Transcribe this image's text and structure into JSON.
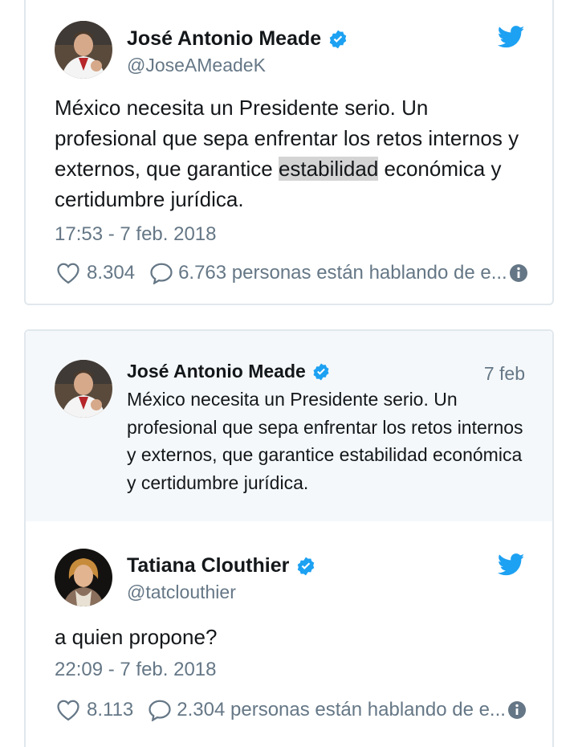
{
  "colors": {
    "accent": "#1da1f2",
    "secondary_text": "#657786",
    "highlight": "#d4d4d4",
    "quoted_bg": "#f5f8fa"
  },
  "tweet1": {
    "name": "José Antonio Meade",
    "handle": "@JoseAMeadeK",
    "text_before": "México necesita un Presidente serio. Un profesional que sepa enfrentar los retos internos y externos, que garantice ",
    "text_highlight": "estabilidad",
    "text_after": " económica y certidumbre jurídica.",
    "timestamp": "17:53 - 7 feb. 2018",
    "likes": "8.304",
    "talking": "6.763 personas están hablando de e...",
    "icons": [
      "verified-badge-icon",
      "twitter-bird-icon",
      "heart-icon",
      "comment-bubble-icon",
      "info-icon"
    ]
  },
  "quoted": {
    "name": "José Antonio Meade",
    "date": "7 feb",
    "text": "México necesita un Presidente serio. Un profesional que sepa enfrentar los retos internos y externos, que garantice estabilidad económica y certidumbre jurídica."
  },
  "tweet2": {
    "name": "Tatiana Clouthier",
    "handle": "@tatclouthier",
    "text": "a quien propone?",
    "timestamp": "22:09 - 7 feb. 2018",
    "likes": "8.113",
    "talking": "2.304 personas están hablando de e...",
    "icons": [
      "verified-badge-icon",
      "twitter-bird-icon",
      "heart-icon",
      "comment-bubble-icon",
      "info-icon"
    ]
  }
}
